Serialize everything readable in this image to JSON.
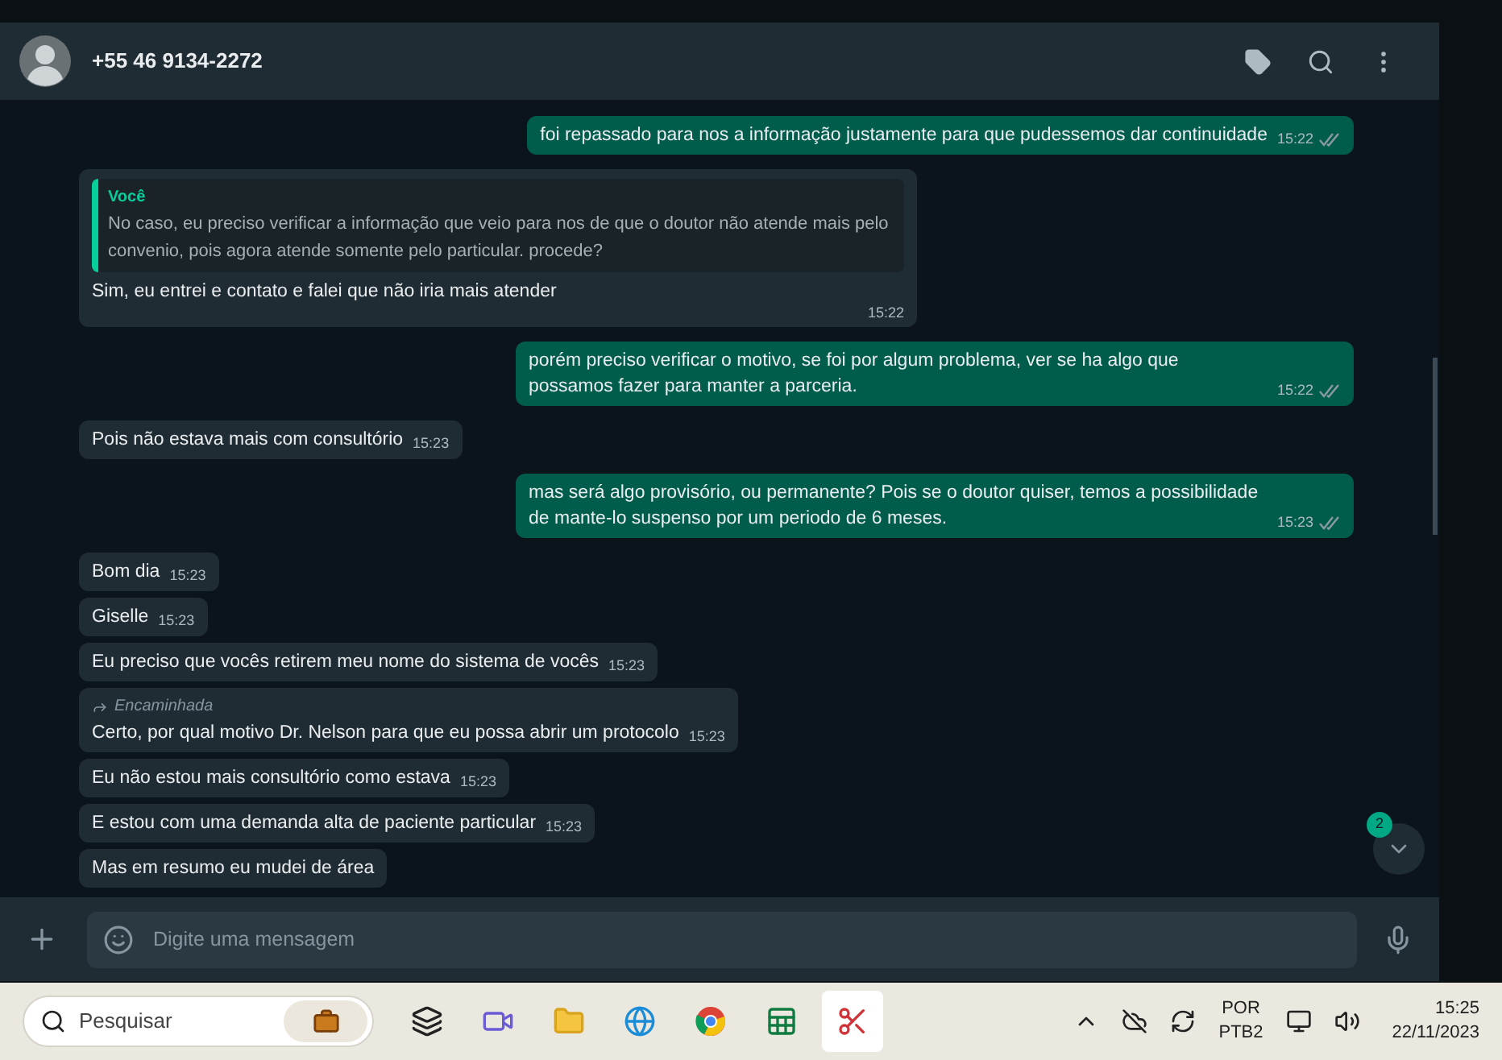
{
  "chat_header": {
    "contact": "+55 46 9134-2272"
  },
  "messages": [
    {
      "kind": "out",
      "text": "foi repassado para nos a informação justamente para que pudessemos dar continuidade",
      "time": "15:22"
    },
    {
      "kind": "in",
      "quote": {
        "author": "Você",
        "text": "No caso, eu preciso verificar a informação que veio para nos de que o doutor não atende mais pelo convenio, pois agora atende somente pelo particular. procede?"
      },
      "text": "Sim, eu entrei e contato e falei que não iria mais atender",
      "time": "15:22"
    },
    {
      "kind": "out",
      "text": "porém preciso verificar o motivo, se foi por algum problema, ver se ha algo que possamos fazer para manter a parceria.",
      "time": "15:22"
    },
    {
      "kind": "in",
      "text": "Pois não estava mais com consultório",
      "time": "15:23"
    },
    {
      "kind": "out",
      "text": "mas será algo provisório, ou permanente? Pois se o doutor quiser, temos a possibilidade de mante-lo suspenso por um periodo de 6 meses.",
      "time": "15:23"
    },
    {
      "kind": "in",
      "text": "Bom dia",
      "time": "15:23"
    },
    {
      "kind": "in",
      "text": "Giselle",
      "time": "15:23"
    },
    {
      "kind": "in",
      "text": "Eu preciso que vocês retirem meu nome do sistema de vocês",
      "time": "15:23"
    },
    {
      "kind": "in",
      "forwarded": "Encaminhada",
      "text": "Certo, por qual motivo Dr. Nelson para que eu possa abrir um protocolo",
      "time": "15:23"
    },
    {
      "kind": "in",
      "text": "Eu não estou mais consultório como estava",
      "time": "15:23"
    },
    {
      "kind": "in",
      "text": "E estou com uma demanda alta de paciente particular",
      "time": "15:23"
    },
    {
      "kind": "in",
      "text": "Mas em resumo eu mudei de área"
    }
  ],
  "scroll_button": {
    "badge": "2"
  },
  "composer": {
    "placeholder": "Digite uma mensagem"
  },
  "taskbar": {
    "search_placeholder": "Pesquisar",
    "language": "POR",
    "layout": "PTB2",
    "time": "15:25",
    "date": "22/11/2023"
  }
}
